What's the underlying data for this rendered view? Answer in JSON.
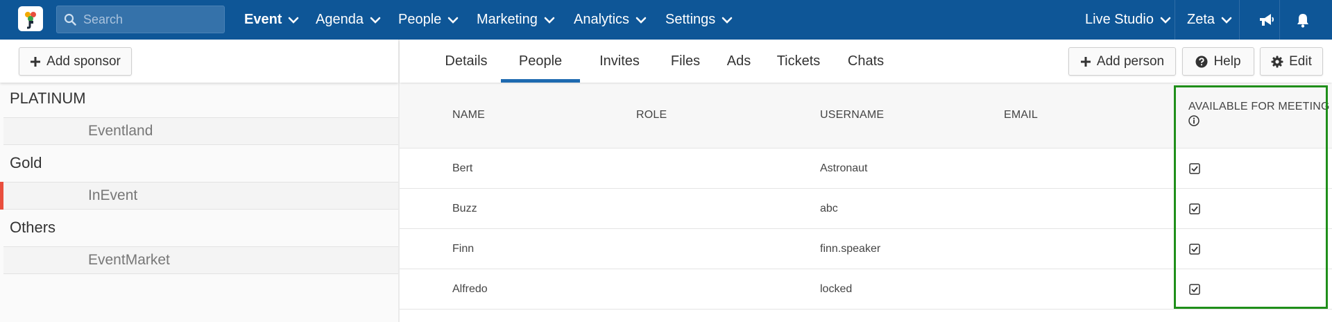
{
  "topbar": {
    "search_placeholder": "Search",
    "nav": [
      "Event",
      "Agenda",
      "People",
      "Marketing",
      "Analytics",
      "Settings"
    ],
    "live_studio": "Live Studio",
    "user": "Zeta",
    "colors": {
      "bar": "#0e5697",
      "accent": "#1e6ab0",
      "active_marker": "#e94e3d",
      "highlight_box": "#1f8f1a"
    }
  },
  "sidebar": {
    "add_sponsor": "Add sponsor",
    "groups": [
      {
        "title": "PLATINUM",
        "items": [
          "Eventland"
        ]
      },
      {
        "title": "Gold",
        "items": [
          "InEvent"
        ]
      },
      {
        "title": "Others",
        "items": [
          "EventMarket"
        ]
      }
    ]
  },
  "tabs": [
    "Details",
    "People",
    "Invites",
    "Files",
    "Ads",
    "Tickets",
    "Chats"
  ],
  "actions": {
    "add_person": "Add person",
    "help": "Help",
    "edit": "Edit"
  },
  "table": {
    "columns": [
      "NAME",
      "ROLE",
      "USERNAME",
      "EMAIL",
      "AVAILABLE FOR MEETING"
    ],
    "rows": [
      {
        "name": "Bert",
        "role": "",
        "username": "Astronaut",
        "email": "",
        "available": true
      },
      {
        "name": "Buzz",
        "role": "",
        "username": "abc",
        "email": "",
        "available": true
      },
      {
        "name": "Finn",
        "role": "",
        "username": "finn.speaker",
        "email": "",
        "available": true
      },
      {
        "name": "Alfredo",
        "role": "",
        "username": "locked",
        "email": "",
        "available": true
      }
    ]
  }
}
